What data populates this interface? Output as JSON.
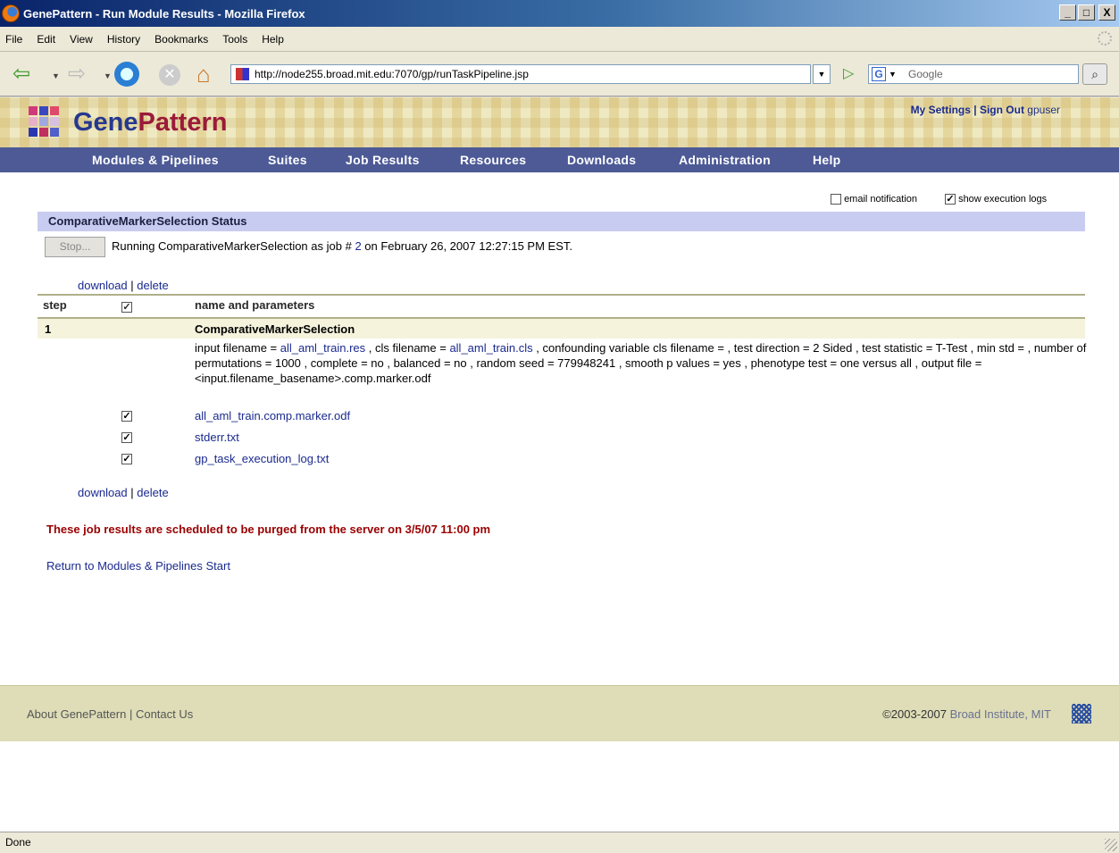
{
  "window": {
    "title": "GenePattern - Run Module Results - Mozilla Firefox",
    "min_label": "_",
    "max_label": "□",
    "close_label": "X"
  },
  "menu": [
    "File",
    "Edit",
    "View",
    "History",
    "Bookmarks",
    "Tools",
    "Help"
  ],
  "nav": {
    "url": "http://node255.broad.mit.edu:7070/gp/runTaskPipeline.jsp",
    "search_engine_letter": "G",
    "search_placeholder": "Google"
  },
  "gp": {
    "title_part1": "Gene",
    "title_part2": "Pattern",
    "my_settings": "My Settings",
    "separator": "|",
    "sign_out": "Sign Out",
    "username": "gpuser",
    "nav_items": [
      "Modules & Pipelines",
      "Suites",
      "Job Results",
      "Resources",
      "Downloads",
      "Administration",
      "Help"
    ]
  },
  "options": {
    "email_label": "email notification",
    "email_checked": false,
    "logs_label": "show execution logs",
    "logs_checked": true
  },
  "status": {
    "header": "ComparativeMarkerSelection Status",
    "stop_label": "Stop...",
    "running_prefix": "Running ComparativeMarkerSelection as job #",
    "job_number": "2",
    "running_suffix": "on February 26, 2007 12:27:15 PM EST."
  },
  "links": {
    "download": "download",
    "sep": "|",
    "delete": "delete"
  },
  "table": {
    "col_step": "step",
    "col_name": "name and parameters",
    "step_number": "1",
    "module_name": "ComparativeMarkerSelection",
    "params": {
      "p1": "input filename = ",
      "input_file": "all_aml_train.res",
      "p2": " , cls filename = ",
      "cls_file": "all_aml_train.cls",
      "p3": " , confounding variable cls filename = , test direction = 2 Sided , test statistic = T-Test , min std = , number of permutations = 1000 , complete = no , balanced = no , random seed = 779948241 , smooth p values = yes , phenotype test = one versus all , output file = <input.filename_basename>.comp.marker.odf"
    },
    "files": [
      "all_aml_train.comp.marker.odf",
      "stderr.txt",
      "gp_task_execution_log.txt"
    ]
  },
  "purge_notice": "These job results are scheduled to be purged from the server on 3/5/07 11:00 pm",
  "return_link": "Return to Modules & Pipelines Start",
  "footer": {
    "about": "About GenePattern",
    "sep": "|",
    "contact": "Contact Us",
    "copyright": "©2003-2007",
    "org": "Broad Institute, MIT"
  },
  "statusbar": {
    "text": "Done"
  },
  "colors": {
    "nav_bg": "#4d5a96",
    "status_header_bg": "#c8ccf0",
    "purge_text": "#9a0000",
    "link": "#1a2a8e"
  }
}
